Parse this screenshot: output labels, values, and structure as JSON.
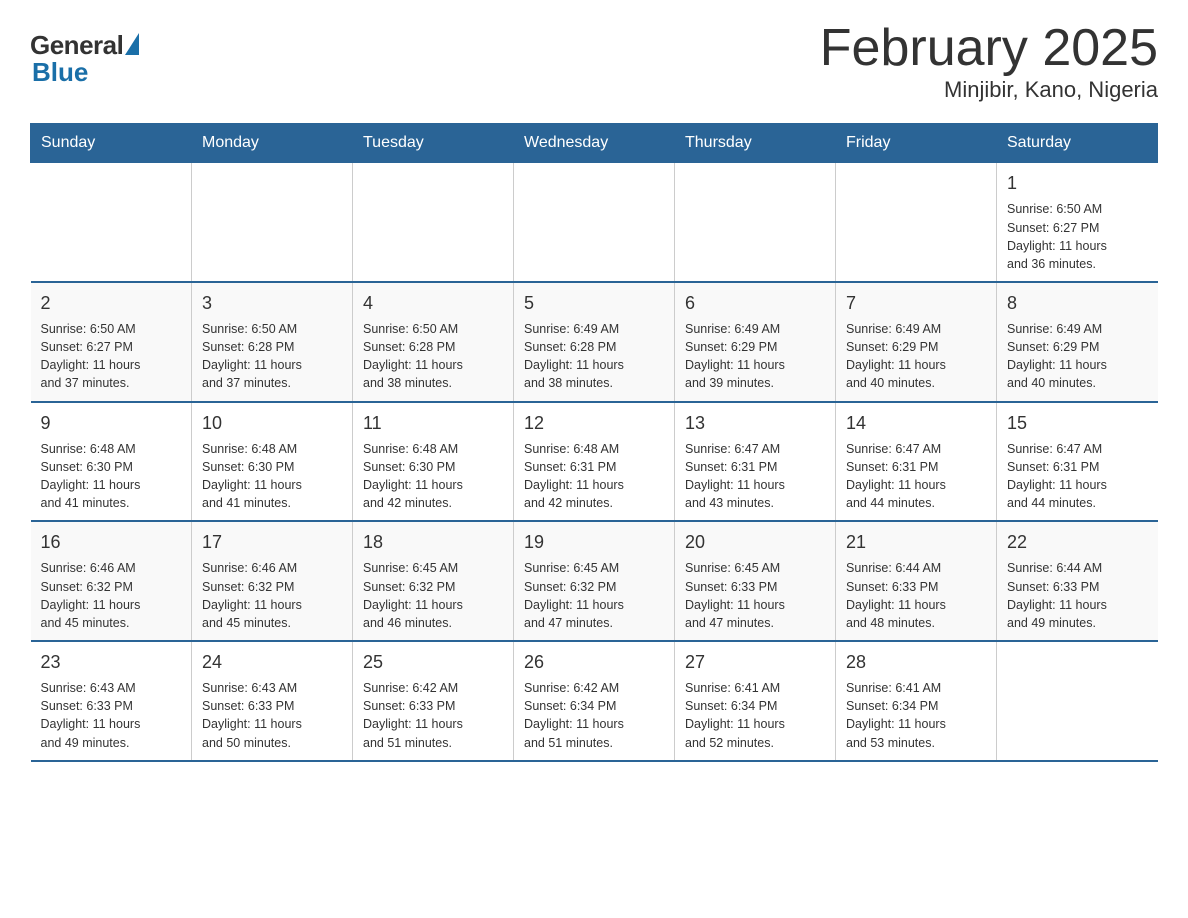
{
  "header": {
    "logo_general": "General",
    "logo_blue": "Blue",
    "month_title": "February 2025",
    "location": "Minjibir, Kano, Nigeria"
  },
  "calendar": {
    "days_of_week": [
      "Sunday",
      "Monday",
      "Tuesday",
      "Wednesday",
      "Thursday",
      "Friday",
      "Saturday"
    ],
    "weeks": [
      [
        {
          "day": "",
          "info": ""
        },
        {
          "day": "",
          "info": ""
        },
        {
          "day": "",
          "info": ""
        },
        {
          "day": "",
          "info": ""
        },
        {
          "day": "",
          "info": ""
        },
        {
          "day": "",
          "info": ""
        },
        {
          "day": "1",
          "info": "Sunrise: 6:50 AM\nSunset: 6:27 PM\nDaylight: 11 hours\nand 36 minutes."
        }
      ],
      [
        {
          "day": "2",
          "info": "Sunrise: 6:50 AM\nSunset: 6:27 PM\nDaylight: 11 hours\nand 37 minutes."
        },
        {
          "day": "3",
          "info": "Sunrise: 6:50 AM\nSunset: 6:28 PM\nDaylight: 11 hours\nand 37 minutes."
        },
        {
          "day": "4",
          "info": "Sunrise: 6:50 AM\nSunset: 6:28 PM\nDaylight: 11 hours\nand 38 minutes."
        },
        {
          "day": "5",
          "info": "Sunrise: 6:49 AM\nSunset: 6:28 PM\nDaylight: 11 hours\nand 38 minutes."
        },
        {
          "day": "6",
          "info": "Sunrise: 6:49 AM\nSunset: 6:29 PM\nDaylight: 11 hours\nand 39 minutes."
        },
        {
          "day": "7",
          "info": "Sunrise: 6:49 AM\nSunset: 6:29 PM\nDaylight: 11 hours\nand 40 minutes."
        },
        {
          "day": "8",
          "info": "Sunrise: 6:49 AM\nSunset: 6:29 PM\nDaylight: 11 hours\nand 40 minutes."
        }
      ],
      [
        {
          "day": "9",
          "info": "Sunrise: 6:48 AM\nSunset: 6:30 PM\nDaylight: 11 hours\nand 41 minutes."
        },
        {
          "day": "10",
          "info": "Sunrise: 6:48 AM\nSunset: 6:30 PM\nDaylight: 11 hours\nand 41 minutes."
        },
        {
          "day": "11",
          "info": "Sunrise: 6:48 AM\nSunset: 6:30 PM\nDaylight: 11 hours\nand 42 minutes."
        },
        {
          "day": "12",
          "info": "Sunrise: 6:48 AM\nSunset: 6:31 PM\nDaylight: 11 hours\nand 42 minutes."
        },
        {
          "day": "13",
          "info": "Sunrise: 6:47 AM\nSunset: 6:31 PM\nDaylight: 11 hours\nand 43 minutes."
        },
        {
          "day": "14",
          "info": "Sunrise: 6:47 AM\nSunset: 6:31 PM\nDaylight: 11 hours\nand 44 minutes."
        },
        {
          "day": "15",
          "info": "Sunrise: 6:47 AM\nSunset: 6:31 PM\nDaylight: 11 hours\nand 44 minutes."
        }
      ],
      [
        {
          "day": "16",
          "info": "Sunrise: 6:46 AM\nSunset: 6:32 PM\nDaylight: 11 hours\nand 45 minutes."
        },
        {
          "day": "17",
          "info": "Sunrise: 6:46 AM\nSunset: 6:32 PM\nDaylight: 11 hours\nand 45 minutes."
        },
        {
          "day": "18",
          "info": "Sunrise: 6:45 AM\nSunset: 6:32 PM\nDaylight: 11 hours\nand 46 minutes."
        },
        {
          "day": "19",
          "info": "Sunrise: 6:45 AM\nSunset: 6:32 PM\nDaylight: 11 hours\nand 47 minutes."
        },
        {
          "day": "20",
          "info": "Sunrise: 6:45 AM\nSunset: 6:33 PM\nDaylight: 11 hours\nand 47 minutes."
        },
        {
          "day": "21",
          "info": "Sunrise: 6:44 AM\nSunset: 6:33 PM\nDaylight: 11 hours\nand 48 minutes."
        },
        {
          "day": "22",
          "info": "Sunrise: 6:44 AM\nSunset: 6:33 PM\nDaylight: 11 hours\nand 49 minutes."
        }
      ],
      [
        {
          "day": "23",
          "info": "Sunrise: 6:43 AM\nSunset: 6:33 PM\nDaylight: 11 hours\nand 49 minutes."
        },
        {
          "day": "24",
          "info": "Sunrise: 6:43 AM\nSunset: 6:33 PM\nDaylight: 11 hours\nand 50 minutes."
        },
        {
          "day": "25",
          "info": "Sunrise: 6:42 AM\nSunset: 6:33 PM\nDaylight: 11 hours\nand 51 minutes."
        },
        {
          "day": "26",
          "info": "Sunrise: 6:42 AM\nSunset: 6:34 PM\nDaylight: 11 hours\nand 51 minutes."
        },
        {
          "day": "27",
          "info": "Sunrise: 6:41 AM\nSunset: 6:34 PM\nDaylight: 11 hours\nand 52 minutes."
        },
        {
          "day": "28",
          "info": "Sunrise: 6:41 AM\nSunset: 6:34 PM\nDaylight: 11 hours\nand 53 minutes."
        },
        {
          "day": "",
          "info": ""
        }
      ]
    ]
  }
}
